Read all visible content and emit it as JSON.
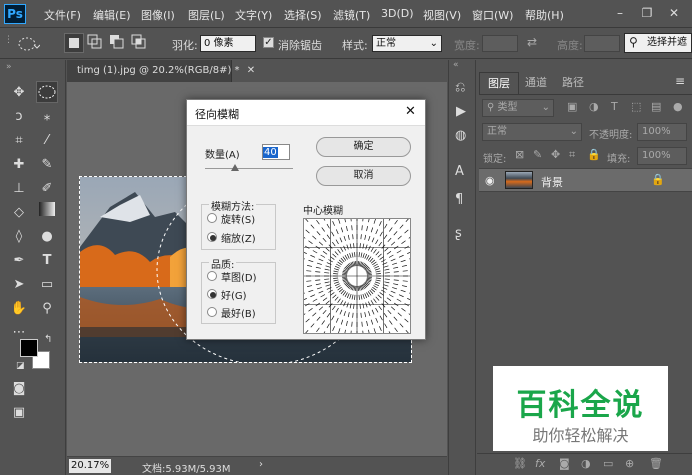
{
  "app": {
    "logo": "Ps"
  },
  "menu": [
    "文件(F)",
    "编辑(E)",
    "图像(I)",
    "图层(L)",
    "文字(Y)",
    "选择(S)",
    "滤镜(T)",
    "3D(D)",
    "视图(V)",
    "窗口(W)",
    "帮助(H)"
  ],
  "options": {
    "feather_label": "羽化:",
    "feather_value": "0 像素",
    "antialias_label": "消除锯齿",
    "style_label": "样式:",
    "style_value": "正常",
    "width_label": "宽度:",
    "height_label": "高度:",
    "select_mask": "选择并遮"
  },
  "document": {
    "tab_title": "timg (1).jpg @ 20.2%(RGB/8#) *",
    "zoom": "20.17%",
    "doc_info": "文档:5.93M/5.93M"
  },
  "dialog": {
    "title": "径向模糊",
    "amount_label": "数量(A)",
    "amount_value": "40",
    "ok": "确定",
    "cancel": "取消",
    "method_label": "模糊方法:",
    "method_spin": "旋转(S)",
    "method_zoom": "缩放(Z)",
    "quality_label": "品质:",
    "quality_draft": "草图(D)",
    "quality_good": "好(G)",
    "quality_best": "最好(B)",
    "center_label": "中心模糊"
  },
  "layers_panel": {
    "tabs": [
      "图层",
      "通道",
      "路径"
    ],
    "filter_kind": "类型",
    "blend_mode": "正常",
    "opacity_label": "不透明度:",
    "opacity_value": "100%",
    "lock_label": "锁定:",
    "fill_label": "填充:",
    "fill_value": "100%",
    "layer_name": "背景"
  },
  "watermark": {
    "title": "百科全说",
    "subtitle": "助你轻松解决",
    "title_color": "#1aa64a"
  }
}
